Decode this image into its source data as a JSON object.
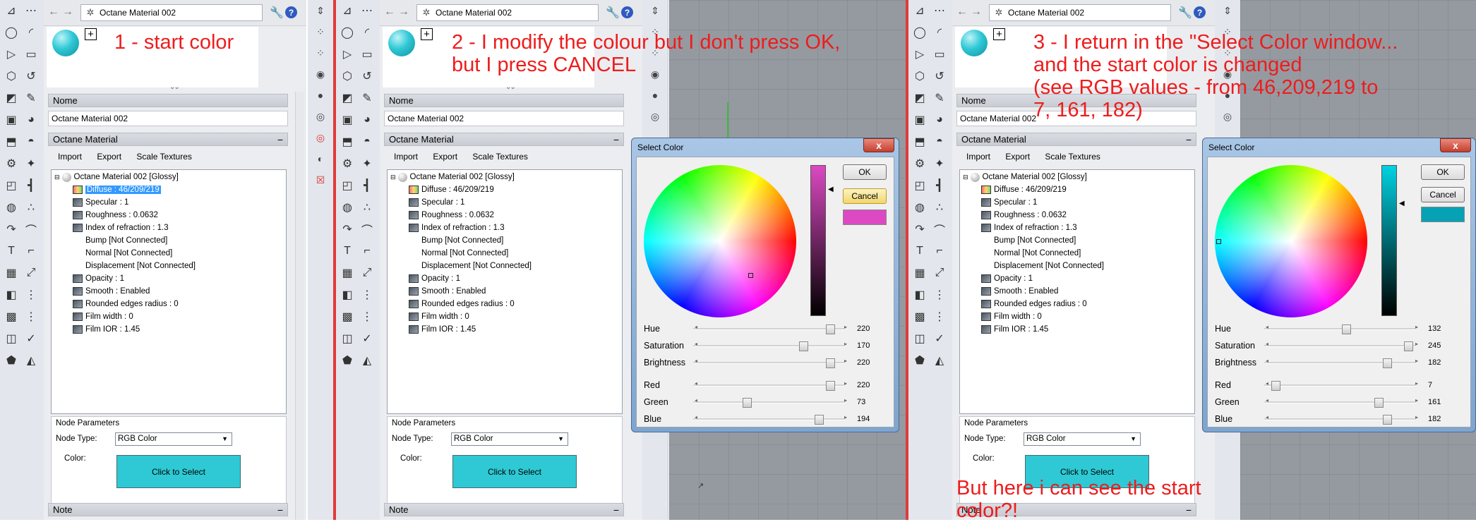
{
  "material": {
    "name": "Octane Material 002",
    "tree_root": "Octane Material 002  [Glossy]"
  },
  "sections": {
    "name": "Nome",
    "octane": "Octane Material",
    "note": "Note",
    "collapse": "−"
  },
  "menu": {
    "import": "Import",
    "export": "Export",
    "scale": "Scale Textures"
  },
  "tree_items": [
    "Diffuse : 46/209/219",
    "Specular : 1",
    "Roughness : 0.0632",
    "Index of refraction : 1.3",
    "Bump  [Not Connected]",
    "Normal  [Not Connected]",
    "Displacement  [Not Connected]",
    "Opacity : 1",
    "Smooth : Enabled",
    "Rounded edges radius : 0",
    "Film width : 0",
    "Film IOR : 1.45"
  ],
  "node_params": {
    "title": "Node Parameters",
    "type_label": "Node Type:",
    "type_value": "RGB Color",
    "color_label": "Color:",
    "button": "Click to Select"
  },
  "annotations": {
    "a1": "1 - start color",
    "a2_l1": "2 - I modify the colour but I don't press OK,",
    "a2_l2": "but I press CANCEL",
    "a3_l1": "3 - I return in the \"Select Color window...",
    "a3_l2": "and the start color is changed",
    "a3_l3": "(see RGB values - from 46,209,219 to",
    "a3_l4": "7, 161, 182)",
    "a4_l1": "But here i can see the start",
    "a4_l2": "color?!"
  },
  "dialog": {
    "title": "Select Color",
    "ok": "OK",
    "cancel": "Cancel",
    "close": "x",
    "labels": {
      "hue": "Hue",
      "sat": "Saturation",
      "bri": "Brightness",
      "red": "Red",
      "green": "Green",
      "blue": "Blue"
    }
  },
  "dialog2_values": {
    "hue": "220",
    "sat": "170",
    "bri": "220",
    "red": "220",
    "green": "73",
    "blue": "194"
  },
  "dialog3_values": {
    "hue": "132",
    "sat": "245",
    "bri": "182",
    "red": "7",
    "green": "161",
    "blue": "182"
  },
  "colors": {
    "start_color": "#2ec9d4",
    "modified_color": "#dc49c2",
    "changed_color": "#07a1b6",
    "annotation_red": "#ee1c1c"
  },
  "icons": {
    "back": "←",
    "forward": "→",
    "wrench": "🔧",
    "help": "?",
    "plus": "+",
    "chevrons": "⌄⌄",
    "select_arrow": "▼",
    "slider_left": "◂",
    "slider_right": "▸"
  },
  "toolbar_icons": [
    "⊿",
    "⋯",
    "◯",
    "◜",
    "▷",
    "▭",
    "⬡",
    "↺",
    "◩",
    "✎",
    "▣",
    "◕",
    "⬒",
    "◓",
    "⚙",
    "✦",
    "◰",
    "┫",
    "◍",
    "∴",
    "↷",
    "⌒",
    "T",
    "⌐",
    "▦",
    "⤢",
    "◧",
    "⋮",
    "▩",
    "⋮",
    "◫",
    "✓",
    "⬟",
    "◭"
  ]
}
